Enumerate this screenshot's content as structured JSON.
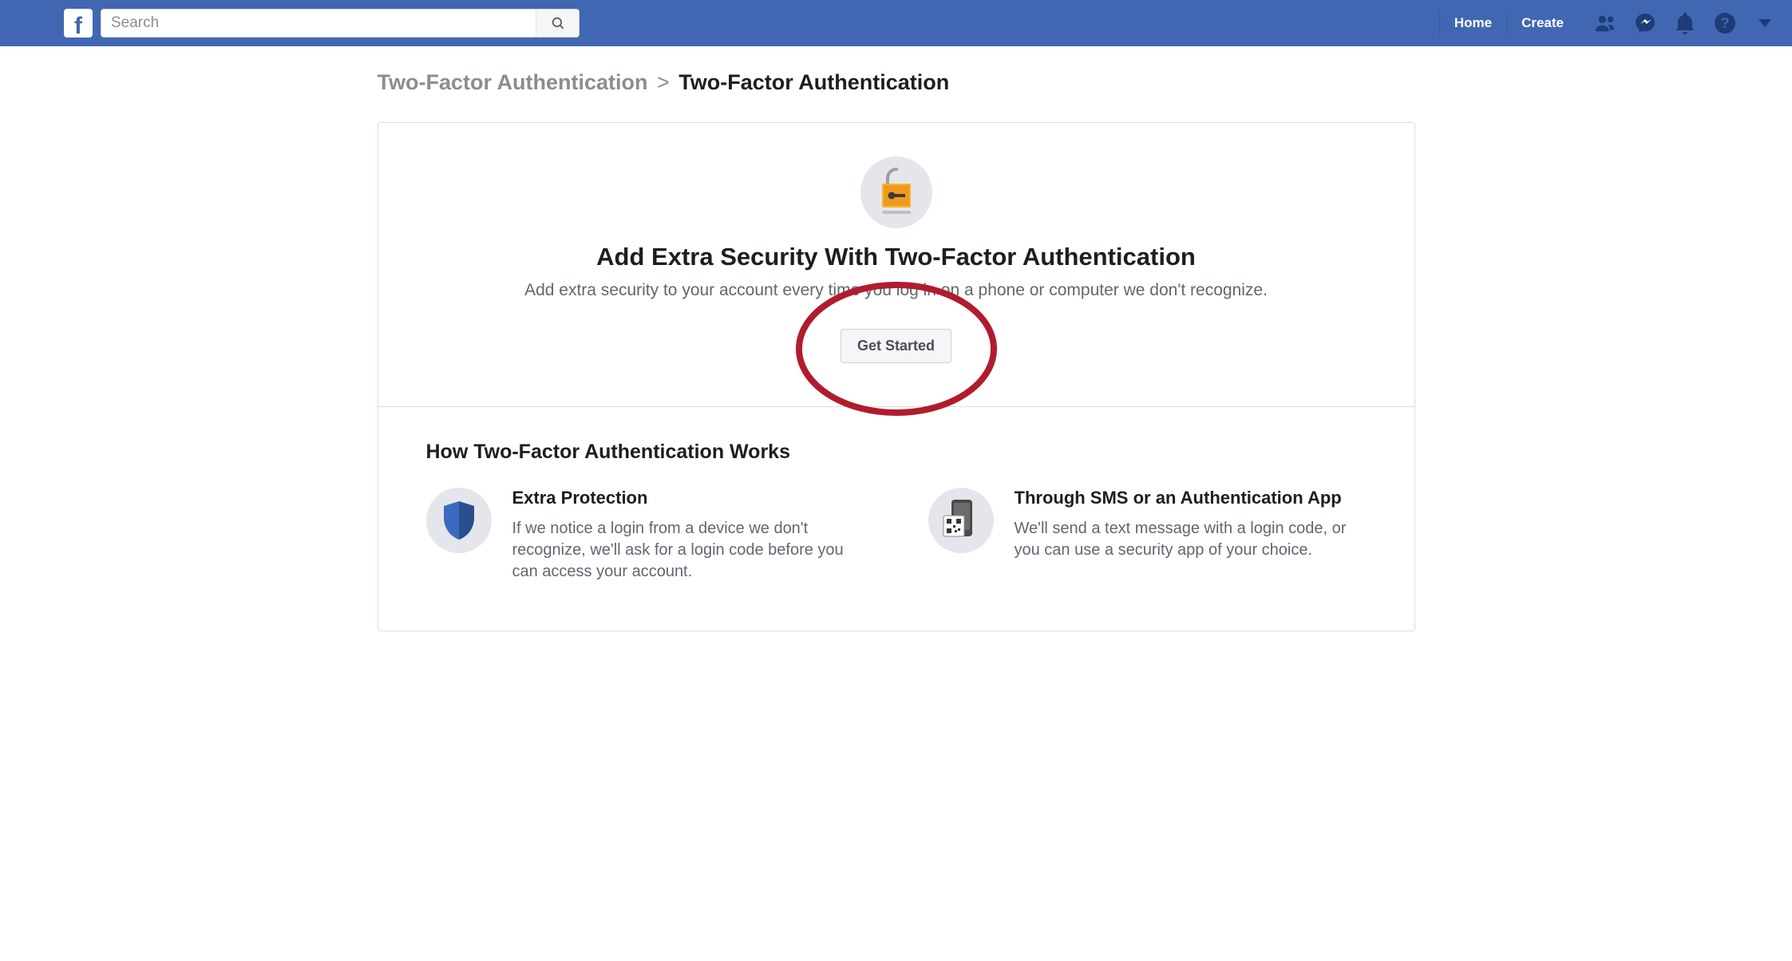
{
  "header": {
    "search_placeholder": "Search",
    "nav": {
      "home": "Home",
      "create": "Create"
    }
  },
  "breadcrumb": {
    "parent": "Two-Factor Authentication",
    "current": "Two-Factor Authentication"
  },
  "hero": {
    "title": "Add Extra Security With Two-Factor Authentication",
    "subtitle": "Add extra security to your account every time you log in on a phone or computer we don't recognize.",
    "button": "Get Started"
  },
  "howto": {
    "heading": "How Two-Factor Authentication Works",
    "items": [
      {
        "title": "Extra Protection",
        "body": "If we notice a login from a device we don't recognize, we'll ask for a login code before you can access your account."
      },
      {
        "title": "Through SMS or an Authentication App",
        "body": "We'll send a text message with a login code, or you can use a security app of your choice."
      }
    ]
  }
}
